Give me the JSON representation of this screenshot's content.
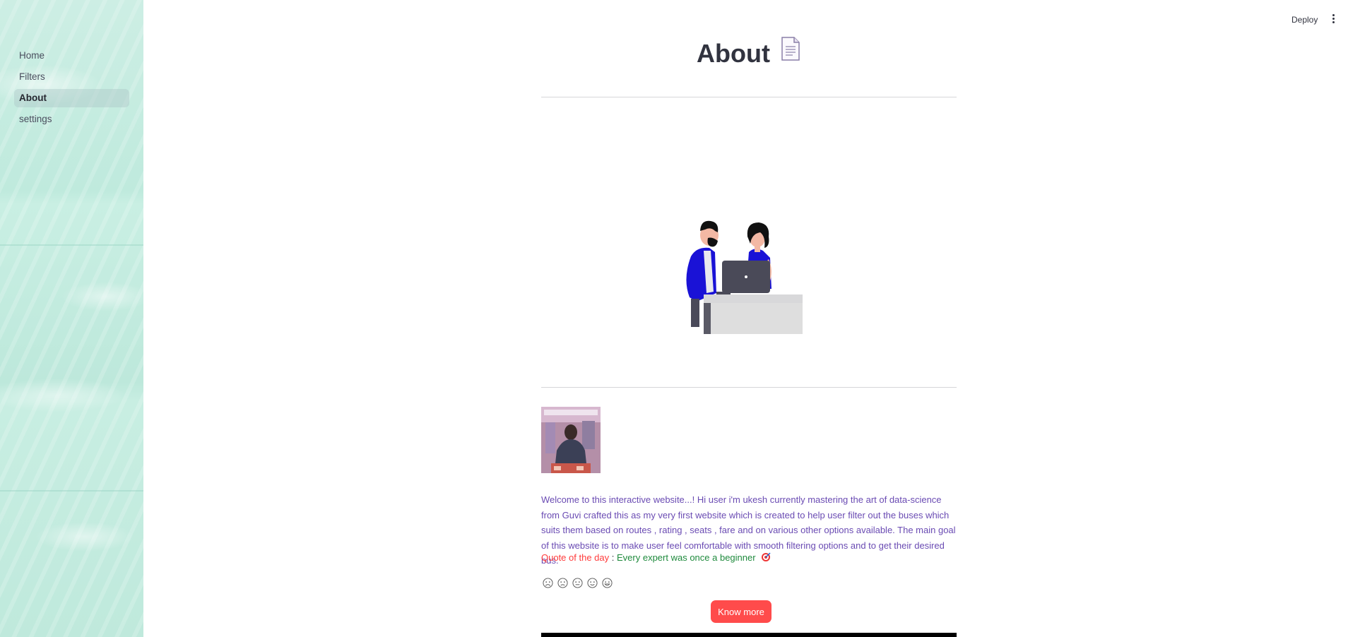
{
  "sidebar": {
    "items": [
      {
        "label": "Home",
        "active": false
      },
      {
        "label": "Filters",
        "active": false
      },
      {
        "label": "About",
        "active": true
      },
      {
        "label": "settings",
        "active": false
      }
    ]
  },
  "header": {
    "deploy_label": "Deploy",
    "menu_icon": "vertical-ellipsis-icon"
  },
  "main": {
    "title": "About",
    "title_icon": "page-facing-up-icon",
    "welcome_text": "Welcome to this interactive website...! Hi user i'm ukesh currently mastering the art of data-science from Guvi crafted this as my very first website which is created to help user filter out the buses which suits them based on routes , rating , seats , fare and on various other options available. The main goal of this website is to make user feel comfortable with smooth filtering options and to get their desired bus.",
    "quote_label": "Quote of the day",
    "quote_separator": ":",
    "quote_text": "Every expert was once a beginner",
    "quote_icon": "direct-hit-target-icon",
    "feedback_faces": [
      "very-sad-face-icon",
      "sad-face-icon",
      "neutral-face-icon",
      "smile-face-icon",
      "very-happy-face-icon"
    ],
    "know_more_label": "Know more"
  },
  "colors": {
    "accent": "#ff4b4b",
    "welcome_text": "#6a4bb3",
    "quote_label": "#ff3b3b",
    "quote_text": "#1e8a3c",
    "sidebar_bg": "#c4ebdf"
  }
}
